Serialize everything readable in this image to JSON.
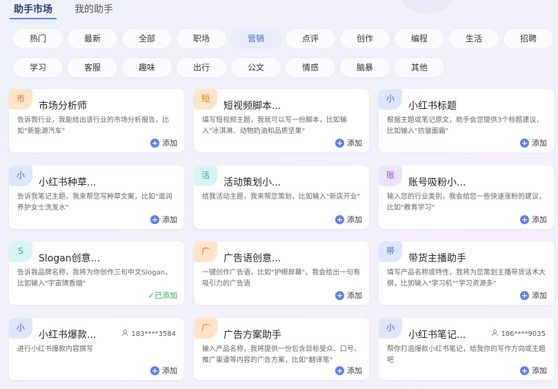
{
  "tabs": [
    {
      "label": "助手市场",
      "active": true
    },
    {
      "label": "我的助手",
      "active": false
    }
  ],
  "categories": {
    "row1": [
      "热门",
      "最新",
      "全部",
      "职场",
      "营销",
      "点评",
      "创作",
      "编程",
      "生活",
      "招聘"
    ],
    "row2": [
      "学习",
      "客服",
      "趣味",
      "出行",
      "公文",
      "情感",
      "脑暴",
      "其他"
    ],
    "active": "营销"
  },
  "add_label": "添加",
  "added_label": "✓已添加",
  "cards": [
    {
      "badge": "市",
      "badge_color": "#ffe4c8",
      "badge_text": "#e07b20",
      "title": "市场分析师",
      "desc": "告诉我行业，我能给出该行业的市场分析报告，比如\"新能源汽车\"",
      "action": "add"
    },
    {
      "badge": "短",
      "badge_color": "#ffe4c8",
      "badge_text": "#e07b20",
      "title": "短视频脚本...",
      "desc": "填写短视频主题，我就可以写一份脚本，比如输入\"冰淇淋、动物奶油和品质坚果\"",
      "action": "add"
    },
    {
      "badge": "小",
      "badge_color": "#dde6fb",
      "badge_text": "#4a64d6",
      "title": "小红书标题",
      "desc": "根据主题或笔记原文，助手会您提供3个标题建议，比如输入\"抗皱面霜\"",
      "action": "add"
    },
    {
      "badge": "小",
      "badge_color": "#dde6fb",
      "badge_text": "#4a64d6",
      "title": "小红书种草...",
      "desc": "告诉我笔记主题，我来帮您写种草文案，比如\"滋润养护女士洗发水\"",
      "action": "add"
    },
    {
      "badge": "活",
      "badge_color": "#d7f4f3",
      "badge_text": "#2aa6a0",
      "title": "活动策划小...",
      "desc": "给我活动主题，我来帮您策划，比如输入\"新店开业\"",
      "action": "add"
    },
    {
      "badge": "账",
      "badge_color": "#ece2fa",
      "badge_text": "#8a5cd6",
      "title": "账号吸粉小...",
      "desc": "输入您的行业类别，我会给您一些快速涨粉的建议，比如\"教育学习\"",
      "action": "add"
    },
    {
      "badge": "S",
      "badge_color": "#d7f4f3",
      "badge_text": "#2aa6a0",
      "title": "Slogan创意...",
      "desc": "告诉我品牌名称，我将为你创作三句中文Slogan，比如输入\"宇宙牌香烟\"",
      "action": "added"
    },
    {
      "badge": "广",
      "badge_color": "#ffe4c8",
      "badge_text": "#e07b20",
      "title": "广告语创意...",
      "desc": "一键创作广告语，比如\"护眼屏幕\"，我会给出一句有吸引力的广告语",
      "action": "add"
    },
    {
      "badge": "带",
      "badge_color": "#dde6fb",
      "badge_text": "#4a64d6",
      "title": "带货主播助手",
      "desc": "填写产品名称或特性，我将为您策划主播带货话术大纲，比如输入\"学习机\"\"学习资源多\"",
      "action": "add"
    },
    {
      "badge": "小",
      "badge_color": "#dde6fb",
      "badge_text": "#4a64d6",
      "title": "小红书爆款...",
      "desc": "进行小红书爆款内容撰写",
      "owner": "183****3584",
      "action": "add"
    },
    {
      "badge": "广",
      "badge_color": "#ffe4c8",
      "badge_text": "#e07b20",
      "title": "广告方案助手",
      "desc": "输入产品名称，我将提供一份包含目标受众、口号、推广渠道等内容的广告方案，比如\"翻译笔\"",
      "action": "add"
    },
    {
      "badge": "小",
      "badge_color": "#dde6fb",
      "badge_text": "#4a64d6",
      "title": "小红书笔记...",
      "desc": "帮你打造爆款小红书笔记，给我你的写作方向或主题吧",
      "owner": "186****9035",
      "action": "add"
    }
  ]
}
